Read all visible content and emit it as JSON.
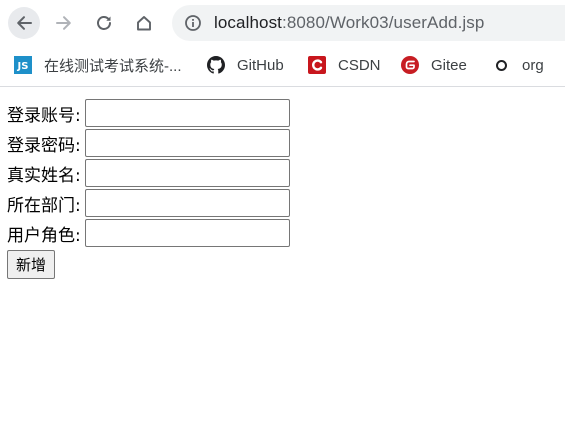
{
  "toolbar": {
    "back_icon": "arrow-left-icon",
    "forward_icon": "arrow-right-icon",
    "reload_icon": "reload-icon",
    "home_icon": "home-icon",
    "info_icon": "info-circle-icon",
    "url_host": "localhost",
    "url_rest": ":8080/Work03/userAdd.jsp"
  },
  "bookmarks": [
    {
      "label": "在线测试考试系统-...",
      "icon": "js-icon",
      "icon_text": "JS"
    },
    {
      "label": "GitHub",
      "icon": "github-icon"
    },
    {
      "label": "CSDN",
      "icon": "csdn-icon"
    },
    {
      "label": "Gitee",
      "icon": "gitee-icon"
    },
    {
      "label": "org",
      "icon": "globe-circle-icon"
    }
  ],
  "form": {
    "fields": [
      {
        "label": "登录账号:",
        "value": ""
      },
      {
        "label": "登录密码:",
        "value": ""
      },
      {
        "label": "真实姓名:",
        "value": ""
      },
      {
        "label": "所在部门:",
        "value": ""
      },
      {
        "label": "用户角色:",
        "value": ""
      }
    ],
    "submit_label": "新增"
  },
  "colors": {
    "omnibox_bg": "#f1f3f4",
    "csdn_red": "#c8161d",
    "gitee_red": "#c71d23",
    "js_blue": "#1e90c9"
  }
}
